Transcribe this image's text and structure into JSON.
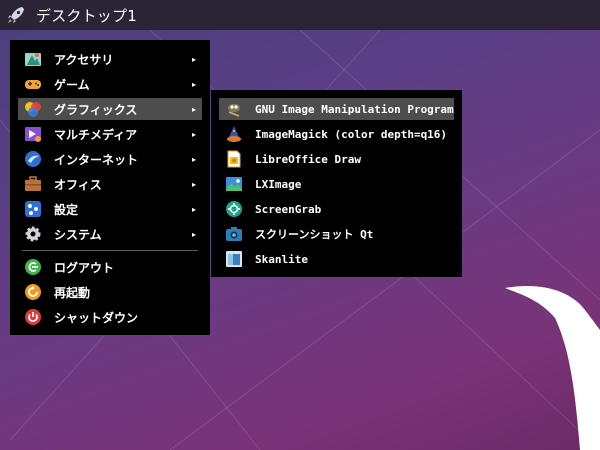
{
  "taskbar": {
    "icon": "rocket-icon",
    "title": "デスクトップ1"
  },
  "main_menu": {
    "items": [
      {
        "label": "アクセサリ",
        "icon": "accessories-icon",
        "has_submenu": true
      },
      {
        "label": "ゲーム",
        "icon": "gamepad-icon",
        "has_submenu": true
      },
      {
        "label": "グラフィックス",
        "icon": "graphics-icon",
        "has_submenu": true,
        "active": true
      },
      {
        "label": "マルチメディア",
        "icon": "multimedia-icon",
        "has_submenu": true
      },
      {
        "label": "インターネット",
        "icon": "globe-icon",
        "has_submenu": true
      },
      {
        "label": "オフィス",
        "icon": "briefcase-icon",
        "has_submenu": true
      },
      {
        "label": "設定",
        "icon": "settings-icon",
        "has_submenu": true
      },
      {
        "label": "システム",
        "icon": "gear-icon",
        "has_submenu": true
      }
    ],
    "session": [
      {
        "label": "ログアウト",
        "icon": "logout-icon"
      },
      {
        "label": "再起動",
        "icon": "reboot-icon"
      },
      {
        "label": "シャットダウン",
        "icon": "power-icon"
      }
    ],
    "arrow_glyph": "▸"
  },
  "submenu": {
    "items": [
      {
        "label": "GNU Image Manipulation Program",
        "icon": "gimp-icon",
        "active": true
      },
      {
        "label": "ImageMagick (color depth=q16)",
        "icon": "imagemagick-wizard-icon"
      },
      {
        "label": "LibreOffice Draw",
        "icon": "libreoffice-draw-icon"
      },
      {
        "label": "LXImage",
        "icon": "image-viewer-icon"
      },
      {
        "label": "ScreenGrab",
        "icon": "screengrab-icon"
      },
      {
        "label": "スクリーンショット Qt",
        "icon": "camera-icon"
      },
      {
        "label": "Skanlite",
        "icon": "scanner-icon"
      }
    ]
  },
  "colors": {
    "menu_bg": "#000000",
    "highlight": "#4d4d4d",
    "taskbar_bg": "#2b2437"
  }
}
